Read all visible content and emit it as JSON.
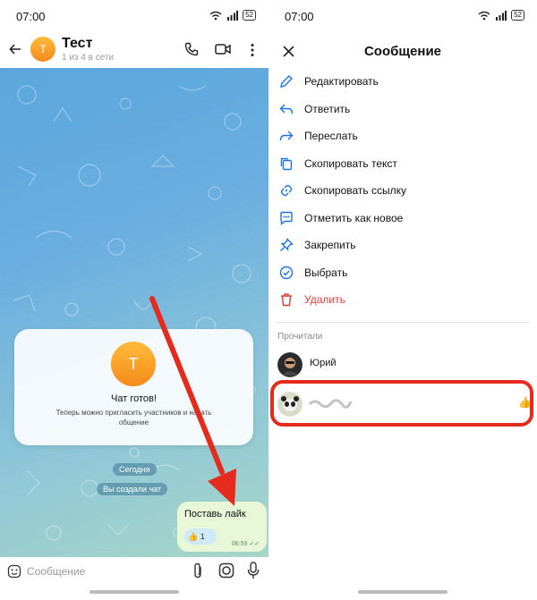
{
  "status_bar": {
    "time": "07:00",
    "battery": "52"
  },
  "chat": {
    "title": "Тест",
    "subtitle": "1 из 4 в сети",
    "avatar_letter": "Т",
    "card": {
      "avatar_letter": "Т",
      "title": "Чат готов!",
      "text": "Теперь можно пригласить участников и начать общение"
    },
    "date_pill": "Сегодня",
    "created_pill": "Вы создали чат",
    "message": {
      "text": "Поставь лайк",
      "reaction_emoji": "👍",
      "reaction_count": "1",
      "time": "06:59"
    },
    "composer_placeholder": "Сообщение"
  },
  "message_panel": {
    "title": "Сообщение",
    "menu": [
      {
        "label": "Редактировать",
        "icon": "pencil-icon"
      },
      {
        "label": "Ответить",
        "icon": "reply-icon"
      },
      {
        "label": "Переслать",
        "icon": "forward-icon"
      },
      {
        "label": "Скопировать текст",
        "icon": "copy-icon"
      },
      {
        "label": "Скопировать ссылку",
        "icon": "link-icon"
      },
      {
        "label": "Отметить как новое",
        "icon": "mark-new-icon"
      },
      {
        "label": "Закрепить",
        "icon": "pin-icon"
      },
      {
        "label": "Выбрать",
        "icon": "check-circle-icon"
      },
      {
        "label": "Удалить",
        "icon": "trash-icon"
      }
    ],
    "readers_label": "Прочитали",
    "readers": [
      {
        "name": "Юрий",
        "reaction": ""
      },
      {
        "name": "",
        "reaction": "👍"
      }
    ]
  },
  "colors": {
    "accent": "#1a73e8",
    "danger": "#e53935",
    "annotation": "#e52a1e"
  }
}
